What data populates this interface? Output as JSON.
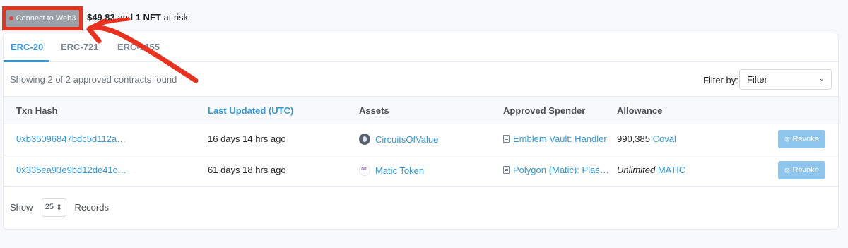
{
  "topbar": {
    "connect_label": "Connect to Web3",
    "risk_amount": "$49.83",
    "risk_and": "and",
    "risk_nft": "1 NFT",
    "risk_suffix": "at risk"
  },
  "tabs": [
    {
      "label": "ERC-20",
      "active": true
    },
    {
      "label": "ERC-721",
      "active": false
    },
    {
      "label": "ERC-1155",
      "active": false
    }
  ],
  "summary": "Showing 2 of 2 approved contracts found",
  "filter": {
    "label": "Filter by:",
    "value": "Filter"
  },
  "table": {
    "headers": [
      "Txn Hash",
      "Last Updated (UTC)",
      "Assets",
      "Approved Spender",
      "Allowance"
    ],
    "rows": [
      {
        "txn_hash": "0xb35096847bdc5d112a…",
        "last_updated": "16 days 14 hrs ago",
        "asset": "CircuitsOfValue",
        "spender": "Emblem Vault: Handler",
        "allowance_amount": "990,385",
        "allowance_token": "Coval",
        "action": "Revoke"
      },
      {
        "txn_hash": "0x335ea93e9bd12de41c…",
        "last_updated": "61 days 18 hrs ago",
        "asset": "Matic Token",
        "spender": "Polygon (Matic): Plas…",
        "allowance_amount": "Unlimited",
        "allowance_token": "MATIC",
        "action": "Revoke"
      }
    ]
  },
  "footer": {
    "show_label": "Show",
    "records_value": "25",
    "records_label": "Records"
  },
  "colors": {
    "accent": "#3498db",
    "annotation_red": "#e8311f",
    "revoke_bg": "#8fc6ee"
  }
}
